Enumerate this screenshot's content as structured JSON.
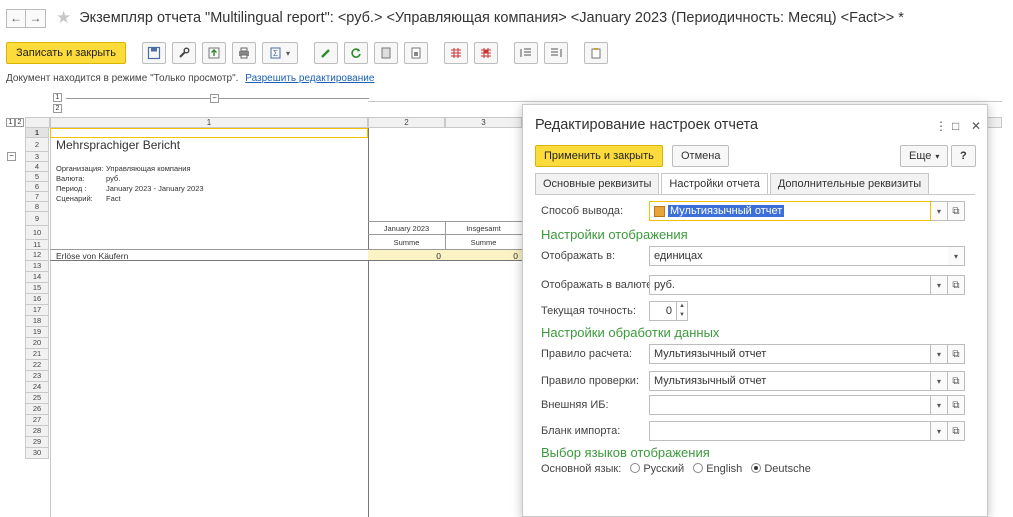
{
  "window": {
    "title": "Экземпляр отчета \"Multilingual report\": <руб.> <Управляющая компания> <January 2023 (Периодичность: Месяц) <Fact>> *"
  },
  "toolbar": {
    "save_close_label": "Записать и закрыть",
    "icons": [
      "save-icon",
      "wrench-icon",
      "upload-icon",
      "print-icon",
      "sum-icon",
      "pencil-icon",
      "refresh-icon",
      "copy-icon",
      "export-icon",
      "grid-red-icon",
      "grid-red2-icon",
      "indent-icon",
      "outdent-icon",
      "clipboard-icon"
    ]
  },
  "notice": {
    "text": "Документ находится в режиме \"Только просмотр\".",
    "link": "Разрешить редактирование"
  },
  "sheet": {
    "group_levels": [
      "1",
      "2"
    ],
    "columns": [
      "1",
      "2",
      "3"
    ],
    "rows": [
      "1",
      "2",
      "3",
      "4",
      "5",
      "6",
      "7",
      "8",
      "9",
      "10",
      "11",
      "12",
      "13",
      "14",
      "15",
      "16",
      "17",
      "18",
      "19",
      "20",
      "21",
      "22",
      "23",
      "24",
      "25",
      "26",
      "27",
      "28",
      "29",
      "30"
    ],
    "report_title": "Mehrsprachiger Bericht",
    "meta": [
      {
        "label": "Организация:",
        "value": "Управляющая компания"
      },
      {
        "label": "Валюта:",
        "value": "руб."
      },
      {
        "label": "Период :",
        "value": "January 2023 - January 2023"
      },
      {
        "label": "Сценарий:",
        "value": "Fact"
      }
    ],
    "col_headers": [
      {
        "period": "January 2023",
        "measure": "Summe"
      },
      {
        "period": "Insgesamt",
        "measure": "Summe"
      }
    ],
    "data_row": {
      "label": "Erlöse von Käufern",
      "values": [
        "0",
        "0"
      ]
    }
  },
  "dialog": {
    "title": "Редактирование настроек отчета",
    "apply_label": "Применить и закрыть",
    "cancel_label": "Отмена",
    "more_label": "Еще",
    "help_label": "?",
    "tabs": [
      "Основные реквизиты",
      "Настройки отчета",
      "Дополнительные реквизиты"
    ],
    "active_tab": 1,
    "output_label": "Способ вывода:",
    "output_value": "Мультиязычный отчет",
    "section_display": "Настройки отображения",
    "display_in_label": "Отображать в:",
    "display_in_value": "единицах",
    "currency_label": "Отображать в валюте:",
    "currency_value": "руб.",
    "precision_label": "Текущая точность:",
    "precision_value": "0",
    "section_processing": "Настройки обработки данных",
    "calc_rule_label": "Правило расчета:",
    "calc_rule_value": "Мультиязычный отчет",
    "check_rule_label": "Правило проверки:",
    "check_rule_value": "Мультиязычный отчет",
    "external_db_label": "Внешняя ИБ:",
    "external_db_value": "",
    "import_form_label": "Бланк импорта:",
    "import_form_value": "",
    "section_languages": "Выбор языков отображения",
    "main_language_label": "Основной язык:",
    "languages": [
      "Русский",
      "English",
      "Deutsche"
    ],
    "selected_language": "Deutsche"
  }
}
